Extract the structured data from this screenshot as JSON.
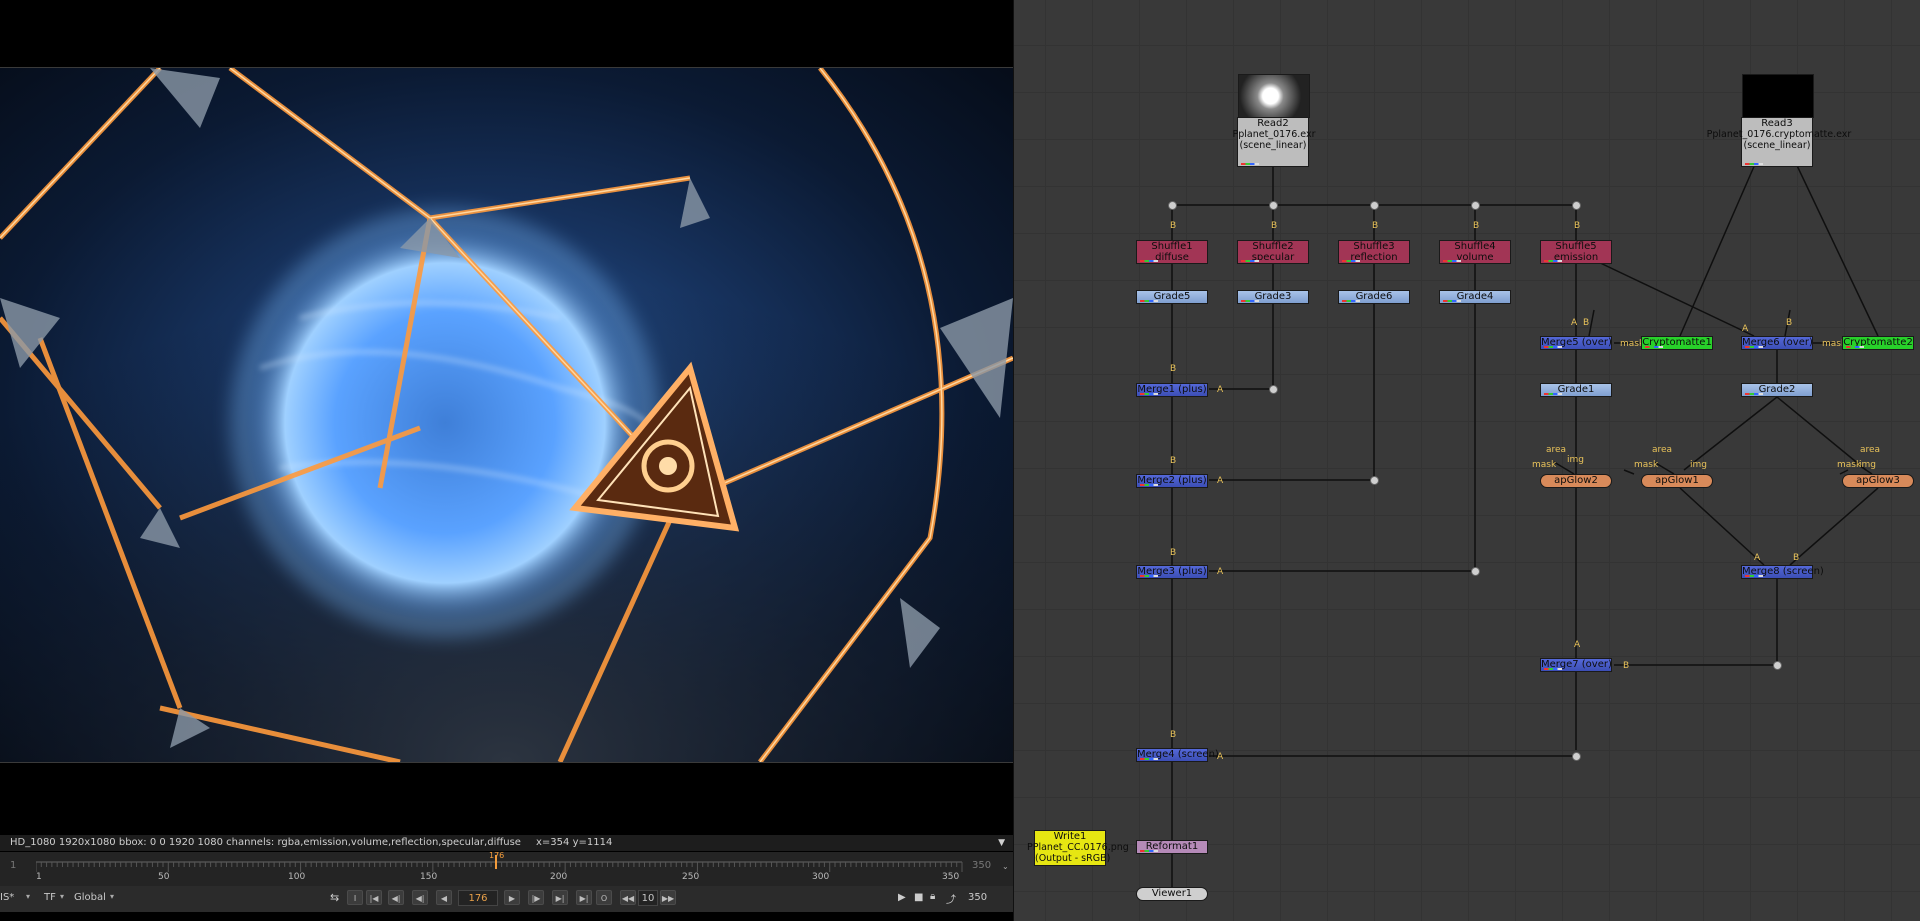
{
  "viewer": {
    "info_format": "HD_1080 1920x1080  bbox: 0 0 1920 1080 channels: rgba,emission,volume,reflection,specular,diffuse",
    "info_coords": "x=354 y=1114",
    "timeline": {
      "start": "1",
      "end": "350",
      "current_frame": "176",
      "ticks": [
        "1",
        "50",
        "100",
        "150",
        "200",
        "250",
        "300",
        "350"
      ],
      "left_label": "1",
      "right_label": "350"
    },
    "transport": {
      "fps_dropdown": "IS*",
      "tf_dropdown": "TF",
      "global_dropdown": "Global",
      "frame_field": "176",
      "increment_field": "10",
      "end_field": "350"
    }
  },
  "nodegraph": {
    "read2": {
      "name": "Read2",
      "file": "Pplanet_0176.exr",
      "colorspace": "(scene_linear)"
    },
    "read3": {
      "name": "Read3",
      "file": "Pplanet_0176.cryptomatte.exr",
      "colorspace": "(scene_linear)"
    },
    "shuffles": [
      {
        "name": "Shuffle1",
        "layer": "diffuse"
      },
      {
        "name": "Shuffle2",
        "layer": "specular"
      },
      {
        "name": "Shuffle3",
        "layer": "reflection"
      },
      {
        "name": "Shuffle4",
        "layer": "volume"
      },
      {
        "name": "Shuffle5",
        "layer": "emission"
      }
    ],
    "grades": [
      "Grade5",
      "Grade3",
      "Grade6",
      "Grade4",
      "Grade1",
      "Grade2"
    ],
    "merges": {
      "merge1": "Merge1 (plus)",
      "merge2": "Merge2 (plus)",
      "merge3": "Merge3 (plus)",
      "merge4": "Merge4 (screen)",
      "merge5": "Merge5 (over)",
      "merge6": "Merge6 (over)",
      "merge7": "Merge7 (over)",
      "merge8": "Merge8 (screen)"
    },
    "cryptomattes": [
      "Cryptomatte1",
      "Cryptomatte2"
    ],
    "glows": [
      "apGlow2",
      "apGlow1",
      "apGlow3"
    ],
    "write1": {
      "name": "Write1",
      "file": "PPlanet_CC.0176.png",
      "colorspace": "(Output - sRGB)"
    },
    "reformat": "Reformat1",
    "viewer_node": "Viewer1",
    "pipe_labels": {
      "a": "A",
      "b": "B",
      "mask": "mask",
      "area": "area",
      "img": "img"
    }
  }
}
